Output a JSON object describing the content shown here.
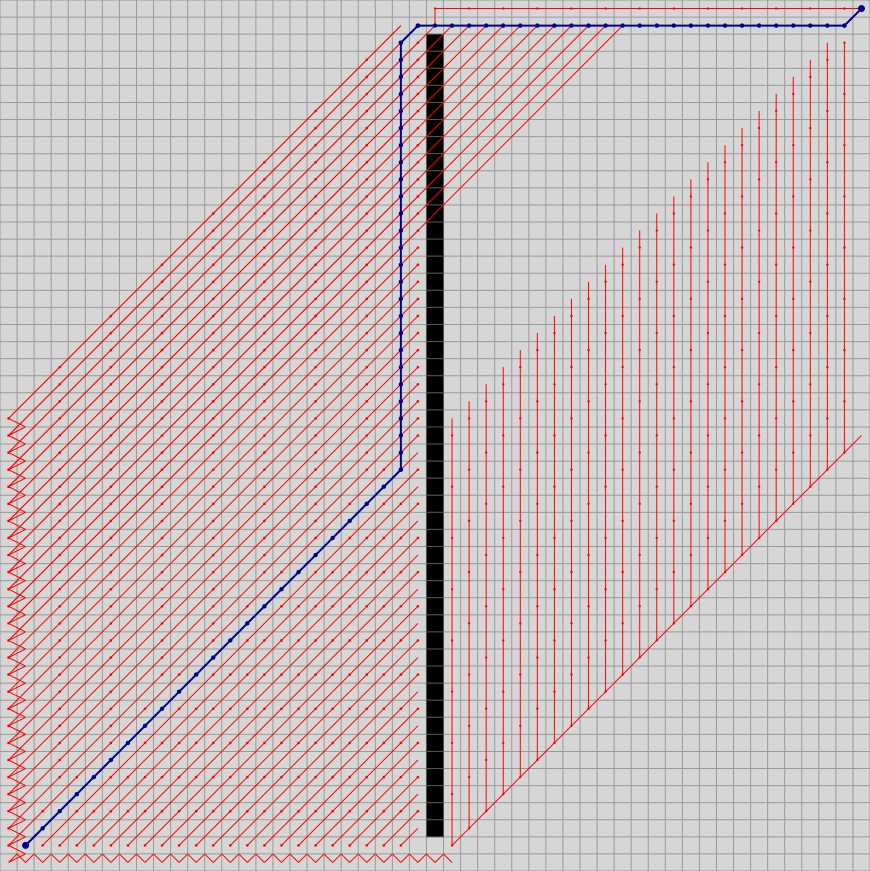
{
  "grid": {
    "cols": 51,
    "rows": 51,
    "background_color": "#d6d6d6",
    "line_color": "#9a9a9a"
  },
  "wall": {
    "column": 25,
    "row_start": 2,
    "row_end": 48,
    "color": "#000000",
    "cell_border_color": "#555555"
  },
  "explored_edges": {
    "color": "#ff0000",
    "description_key": "red search tree"
  },
  "path": {
    "color": "#00008b",
    "points": [
      [
        1,
        49
      ],
      [
        23,
        27
      ],
      [
        23,
        2
      ],
      [
        24,
        1
      ],
      [
        49,
        1
      ],
      [
        50,
        0
      ]
    ]
  },
  "start_cell": [
    1,
    49
  ],
  "goal_cell": [
    50,
    0
  ]
}
